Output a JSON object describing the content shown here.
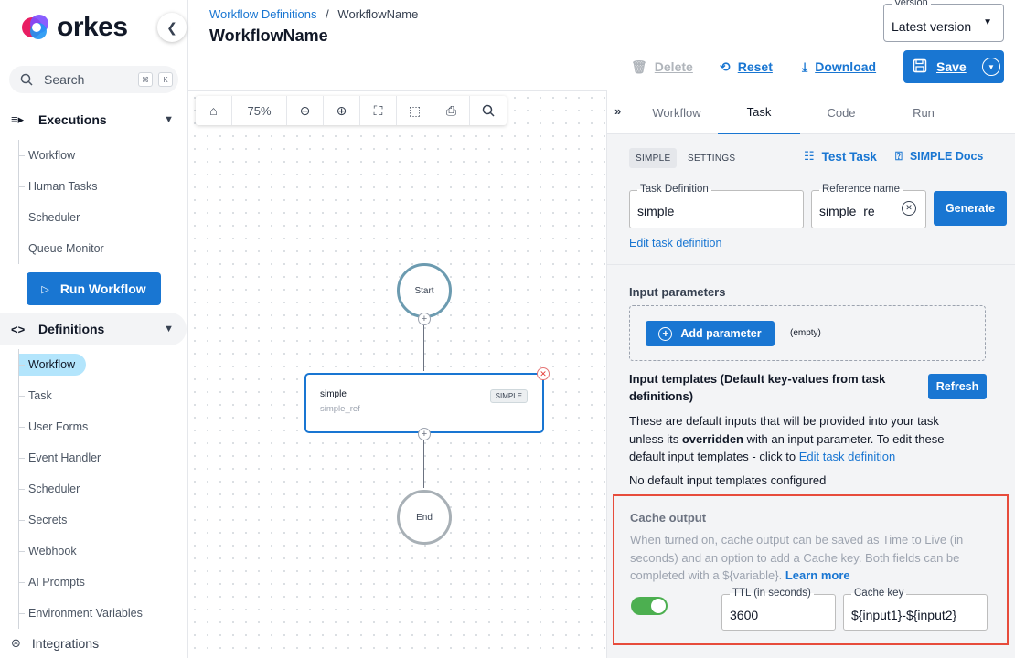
{
  "app": {
    "logo_text": "orkes",
    "brand_colors": [
      "#e91e63",
      "#7c4dff",
      "#2196f3"
    ]
  },
  "sidebar": {
    "search": {
      "label": "Search",
      "shortcut": [
        "⌘",
        "K"
      ]
    },
    "executions": {
      "label": "Executions",
      "items": [
        {
          "label": "Workflow"
        },
        {
          "label": "Human Tasks"
        },
        {
          "label": "Scheduler"
        },
        {
          "label": "Queue Monitor"
        }
      ]
    },
    "run_workflow_label": "Run Workflow",
    "definitions": {
      "label": "Definitions",
      "items": [
        {
          "label": "Workflow",
          "active": true
        },
        {
          "label": "Task"
        },
        {
          "label": "User Forms"
        },
        {
          "label": "Event Handler"
        },
        {
          "label": "Scheduler"
        },
        {
          "label": "Secrets"
        },
        {
          "label": "Webhook"
        },
        {
          "label": "AI Prompts"
        },
        {
          "label": "Environment Variables"
        }
      ]
    },
    "integrations_label": "Integrations"
  },
  "header": {
    "breadcrumb_link": "Workflow Definitions",
    "breadcrumb_sep": "/",
    "breadcrumb_current": "WorkflowName",
    "title": "WorkflowName",
    "version": {
      "legend": "Version",
      "value": "Latest version"
    },
    "toolbar": {
      "delete_label": "Delete",
      "reset_label": "Reset",
      "download_label": "Download",
      "save_label": "Save"
    }
  },
  "canvas": {
    "zoom": "75%",
    "tools": [
      "home-icon",
      "zoom-out-icon",
      "zoom-in-icon",
      "fit-view-icon",
      "select-icon",
      "print-icon",
      "search-icon"
    ],
    "start_label": "Start",
    "end_label": "End",
    "task": {
      "name": "simple",
      "ref": "simple_ref",
      "type": "SIMPLE"
    }
  },
  "panel": {
    "tabs": [
      {
        "label": "Workflow"
      },
      {
        "label": "Task",
        "active": true
      },
      {
        "label": "Code"
      },
      {
        "label": "Run"
      }
    ],
    "chip_simple": "SIMPLE",
    "chip_settings": "SETTINGS",
    "test_task": "Test Task",
    "docs": "SIMPLE Docs",
    "task_definition": {
      "legend": "Task Definition",
      "value": "simple"
    },
    "reference_name": {
      "legend": "Reference name",
      "value": "simple_re"
    },
    "generate": "Generate",
    "edit_link": "Edit task definition",
    "input_params_label": "Input parameters",
    "add_param": "Add parameter",
    "empty": "(empty)",
    "templates_title": "Input templates (Default key-values from task definitions)",
    "refresh": "Refresh",
    "desc_a": "These are default inputs that will be provided into your task unless its ",
    "desc_bold": "overridden",
    "desc_b": " with an input parameter. To edit these default input templates - click to ",
    "desc_link": "Edit task definition",
    "no_default": "No default input templates configured",
    "cache": {
      "title": "Cache output",
      "desc": "When turned on, cache output can be saved as Time to Live (in seconds) and an option to add a Cache key. Both fields can be completed with a ${variable}. ",
      "learn_more": "Learn more",
      "enabled": true,
      "ttl": {
        "legend": "TTL (in seconds)",
        "value": "3600"
      },
      "key": {
        "legend": "Cache key",
        "value": "${input1}-${input2}"
      }
    }
  }
}
